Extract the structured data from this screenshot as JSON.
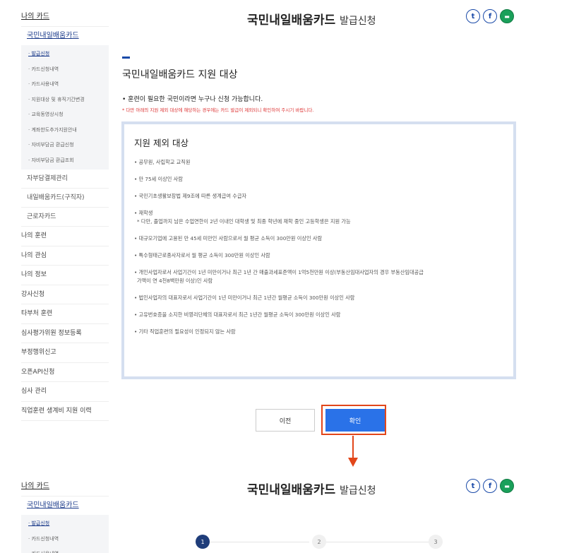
{
  "header": {
    "title": "국민내일배움카드",
    "title_suffix": "발급신청",
    "share_icons": [
      "twitter-icon",
      "facebook-icon",
      "print-icon"
    ]
  },
  "sidebar": {
    "top": "나의 카드",
    "sub_active": "국민내일배움카드",
    "sub_items": [
      "· 발급신청",
      "· 카드신청내역",
      "· 카드사용내역",
      "· 지원대상 및 휴직기간변경",
      "· 교육동영상시청",
      "· 계좌한도추가지원안내",
      "· 자비부담금 환급신청",
      "· 자비부담금 환급조회"
    ],
    "sub_others": [
      "자부담결제관리",
      "내일배움카드(구직자)",
      "근로자카드"
    ],
    "main_items": [
      "나의 훈련",
      "나의 관심",
      "나의 정보",
      "강사신청",
      "타부처 훈련",
      "심사평가위원 정보등록",
      "부정행위신고",
      "오픈API신청",
      "심사 관리",
      "직업훈련 생계비 지원 이력"
    ]
  },
  "content": {
    "section_title": "국민내일배움카드 지원 대상",
    "lead": "• 훈련이 필요한 국민이라면 누구나 신청 가능합니다.",
    "note": "* 다만 아래의 지원 제외 대상에 해당하는 경우에는 카드 발급이 제외되니 확인하여 주시기 바랍니다.",
    "box_title": "지원 제외 대상",
    "criteria": [
      "• 공무원, 사립학교 교직원",
      "• 만 75세 이상인 사람",
      "• 국민기초생활보장법 제9조에 따른 생계급여 수급자",
      "• 재학생",
      "• 대규모기업에 고용된 만 45세 미만인 사람으로서 월 평균 소득이 300만원 이상인 사람",
      "• 특수형태근로종사자로서 월 평균 소득이 300만원 이상인 사람",
      "• 개인사업자로서 사업기간이 1년 미만이거나 최근 1년 간 매출과세표준액이 1억5천만원 이상(부동산임대사업자의 경우 부동산임대공급",
      "• 법인사업자의 대표자로서 사업기간이 1년 미만이거나 최근 1년간 월평균 소득이 300만원 이상인 사람",
      "• 고유번호증을 소지한 비영리단체의 대표자로서 최근 1년간 월평균 소득이 300만원 이상인 사람",
      "• 기타 직업훈련의 필요성이 인정되지 않는 사람"
    ],
    "criteria_sub": {
      "student": "* 다만, 졸업까지 남은 수업연한이 2년 이내인 대학생 및 최종 학년에 재학 중인 고등학생은 지원 가능",
      "business": "가액이 연 4천8백만원 이상)인 사람"
    }
  },
  "buttons": {
    "prev": "이전",
    "ok": "확인"
  },
  "steps": [
    "1",
    "2",
    "3"
  ],
  "colors": {
    "accent": "#1a4aa8",
    "primary_button": "#2a72e8",
    "highlight": "#e2461a",
    "active_step": "#1f3d7a"
  }
}
